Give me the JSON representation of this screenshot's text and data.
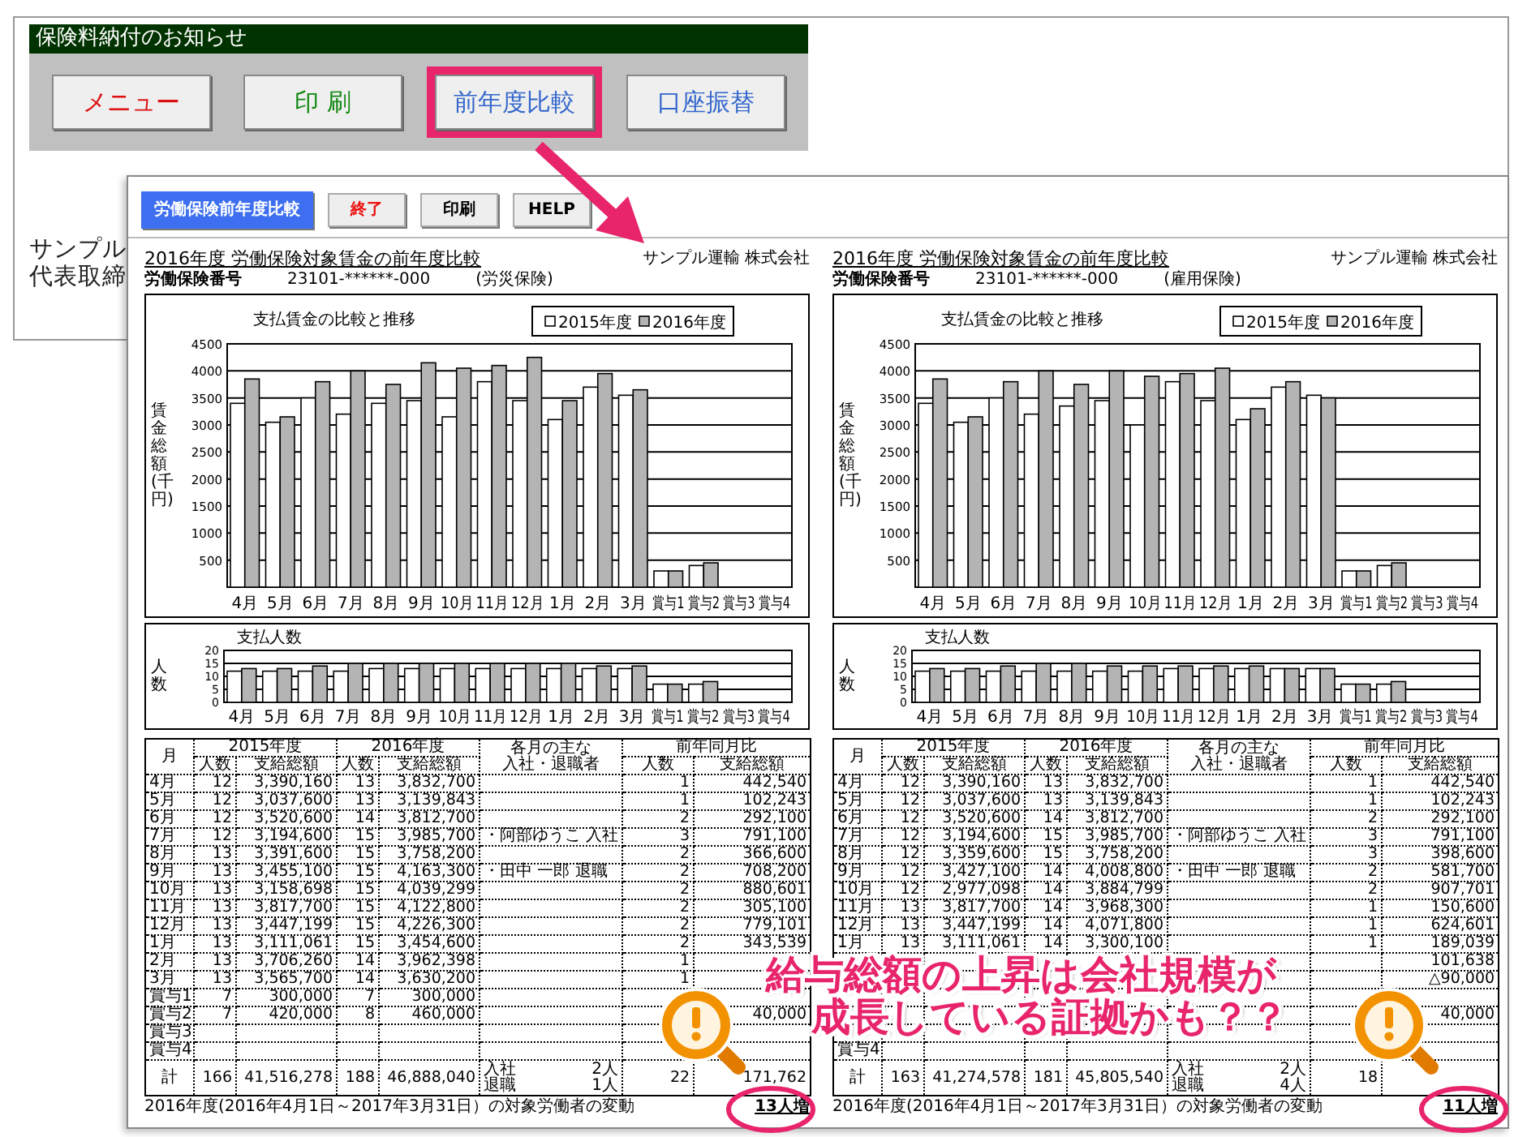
{
  "back_window": {
    "title": "保険料納付のお知らせ",
    "buttons": [
      {
        "label": "メニュー",
        "color": "#dd1111",
        "highlighted": false
      },
      {
        "label": "印 刷",
        "color": "#118811",
        "highlighted": false
      },
      {
        "label": "前年度比較",
        "color": "#3366cc",
        "highlighted": true
      },
      {
        "label": "口座振替",
        "color": "#3366cc",
        "highlighted": false
      }
    ],
    "body_lines": [
      "サンプル",
      "代表取締"
    ]
  },
  "front_window": {
    "toolbar": [
      {
        "label": "労働保険前年度比較",
        "kind": "title"
      },
      {
        "label": "終了",
        "kind": "button",
        "color": "#ee1111"
      },
      {
        "label": "印刷",
        "kind": "button",
        "color": "#000000"
      },
      {
        "label": "HELP",
        "kind": "button",
        "color": "#000000"
      }
    ],
    "reports": [
      {
        "title": "2016年度 労働保険対象賃金の前年度比較",
        "company": "サンプル運輸 株式会社",
        "number_label": "労働保険番号",
        "number": "23101-******-000",
        "insurance_type": "(労災保険)",
        "wage_chart": {
          "chart_data": {
            "type": "bar",
            "title": "支払賃金の比較と推移",
            "ylabel": "賃金総額(千円)",
            "grid": true,
            "legend": "top-right",
            "categories": [
              "4月",
              "5月",
              "6月",
              "7月",
              "8月",
              "9月",
              "10月",
              "11月",
              "12月",
              "1月",
              "2月",
              "3月",
              "賞与1",
              "賞与2",
              "賞与3",
              "賞与4"
            ],
            "ylim": [
              0,
              4500
            ],
            "yticks": [
              500,
              1000,
              1500,
              2000,
              2500,
              3000,
              3500,
              4000,
              4500
            ],
            "series": [
              {
                "name": "2015年度",
                "color": "#ffffff",
                "values": [
                  3400,
                  3050,
                  3500,
                  3200,
                  3400,
                  3450,
                  3150,
                  3800,
                  3450,
                  3100,
                  3700,
                  3550,
                  300,
                  400,
                  null,
                  null
                ]
              },
              {
                "name": "2016年度",
                "color": "#b4b4b4",
                "values": [
                  3850,
                  3150,
                  3800,
                  4000,
                  3750,
                  4150,
                  4050,
                  4100,
                  4250,
                  3450,
                  3950,
                  3650,
                  300,
                  450,
                  null,
                  null
                ]
              }
            ]
          }
        },
        "headcount_chart": {
          "chart_data": {
            "type": "bar",
            "title": "支払人数",
            "ylabel": "人数",
            "grid": true,
            "categories": [
              "4月",
              "5月",
              "6月",
              "7月",
              "8月",
              "9月",
              "10月",
              "11月",
              "12月",
              "1月",
              "2月",
              "3月",
              "賞与1",
              "賞与2",
              "賞与3",
              "賞与4"
            ],
            "ylim": [
              0,
              20
            ],
            "yticks": [
              0,
              5,
              10,
              15,
              20
            ],
            "series": [
              {
                "color": "#ffffff",
                "values": [
                  12,
                  12,
                  12,
                  12,
                  13,
                  13,
                  13,
                  13,
                  13,
                  13,
                  13,
                  13,
                  7,
                  7,
                  null,
                  null
                ]
              },
              {
                "color": "#b4b4b4",
                "values": [
                  13,
                  13,
                  14,
                  15,
                  15,
                  15,
                  15,
                  15,
                  15,
                  15,
                  14,
                  14,
                  7,
                  8,
                  null,
                  null
                ]
              }
            ]
          }
        },
        "table": {
          "columns": [
            {
              "lines": [
                "月"
              ]
            },
            {
              "label": "2015年度",
              "colspan": 2,
              "sub": [
                "人数",
                "支給総額"
              ]
            },
            {
              "label": "2016年度",
              "colspan": 2,
              "sub": [
                "人数",
                "支給総額"
              ]
            },
            {
              "lines": [
                "各月の主な",
                "入社・退職者"
              ]
            },
            {
              "label": "前年同月比",
              "colspan": 2,
              "sub": [
                "人数",
                "支給総額"
              ]
            }
          ],
          "rows": [
            {
              "kind": "month",
              "cells": [
                "4月",
                "12",
                "3,390,160",
                "13",
                "3,832,700",
                null,
                "1",
                "442,540"
              ]
            },
            {
              "kind": "month",
              "cells": [
                "5月",
                "12",
                "3,037,600",
                "13",
                "3,139,843",
                null,
                "1",
                "102,243"
              ]
            },
            {
              "kind": "month",
              "cells": [
                "6月",
                "12",
                "3,520,600",
                "14",
                "3,812,700",
                null,
                "2",
                "292,100"
              ]
            },
            {
              "kind": "month",
              "cells": [
                "7月",
                "12",
                "3,194,600",
                "15",
                "3,985,700",
                "・阿部ゆうこ 入社",
                "3",
                "791,100"
              ]
            },
            {
              "kind": "month",
              "cells": [
                "8月",
                "13",
                "3,391,600",
                "15",
                "3,758,200",
                null,
                "2",
                "366,600"
              ]
            },
            {
              "kind": "month",
              "cells": [
                "9月",
                "13",
                "3,455,100",
                "15",
                "4,163,300",
                "・田中 一郎 退職",
                "2",
                "708,200"
              ]
            },
            {
              "kind": "month",
              "cells": [
                "10月",
                "13",
                "3,158,698",
                "15",
                "4,039,299",
                null,
                "2",
                "880,601"
              ]
            },
            {
              "kind": "month",
              "cells": [
                "11月",
                "13",
                "3,817,700",
                "15",
                "4,122,800",
                null,
                "2",
                "305,100"
              ]
            },
            {
              "kind": "month",
              "cells": [
                "12月",
                "13",
                "3,447,199",
                "15",
                "4,226,300",
                null,
                "2",
                "779,101"
              ]
            },
            {
              "kind": "month",
              "cells": [
                "1月",
                "13",
                "3,111,061",
                "15",
                "3,454,600",
                null,
                "2",
                "343,539"
              ]
            },
            {
              "kind": "month",
              "cells": [
                "2月",
                "13",
                "3,706,260",
                "14",
                "3,962,398",
                null,
                "1",
                null
              ]
            },
            {
              "kind": "month",
              "cells": [
                "3月",
                "13",
                "3,565,700",
                "14",
                "3,630,200",
                null,
                "1",
                null
              ]
            },
            {
              "kind": "month",
              "cells": [
                "賞与1",
                "7",
                "300,000",
                "7",
                "300,000",
                null,
                null,
                null
              ]
            },
            {
              "kind": "month",
              "cells": [
                "賞与2",
                "7",
                "420,000",
                "8",
                "460,000",
                null,
                null,
                "40,000"
              ]
            },
            {
              "kind": "month",
              "cells": [
                "賞与3",
                null,
                null,
                null,
                null,
                null,
                null,
                null
              ]
            },
            {
              "kind": "month",
              "cells": [
                "賞与4",
                null,
                null,
                null,
                null,
                null,
                null,
                null
              ]
            },
            {
              "kind": "total",
              "cells": [
                "計",
                "166",
                "41,516,278",
                "188",
                "46,888,040",
                [
                  [
                    "入社",
                    "2人"
                  ],
                  [
                    "退職",
                    "1人"
                  ]
                ],
                "22",
                "171,762"
              ]
            }
          ]
        },
        "footer": {
          "text": "2016年度(2016年4月1日～2017年3月31日）の対象労働者の変動",
          "change": "13人増"
        }
      },
      {
        "title": "2016年度 労働保険対象賃金の前年度比較",
        "company": "サンプル運輸 株式会社",
        "number_label": "労働保険番号",
        "number": "23101-******-000",
        "insurance_type": "(雇用保険)",
        "wage_chart": {
          "chart_data": {
            "type": "bar",
            "title": "支払賃金の比較と推移",
            "ylabel": "賃金総額(千円)",
            "grid": true,
            "legend": "top-right",
            "categories": [
              "4月",
              "5月",
              "6月",
              "7月",
              "8月",
              "9月",
              "10月",
              "11月",
              "12月",
              "1月",
              "2月",
              "3月",
              "賞与1",
              "賞与2",
              "賞与3",
              "賞与4"
            ],
            "ylim": [
              0,
              4500
            ],
            "yticks": [
              500,
              1000,
              1500,
              2000,
              2500,
              3000,
              3500,
              4000,
              4500
            ],
            "series": [
              {
                "name": "2015年度",
                "color": "#ffffff",
                "values": [
                  3400,
                  3050,
                  3500,
                  3200,
                  3350,
                  3450,
                  3000,
                  3800,
                  3450,
                  3100,
                  3700,
                  3550,
                  300,
                  400,
                  null,
                  null
                ]
              },
              {
                "name": "2016年度",
                "color": "#b4b4b4",
                "values": [
                  3850,
                  3150,
                  3800,
                  4000,
                  3750,
                  4000,
                  3900,
                  3950,
                  4050,
                  3300,
                  3800,
                  3500,
                  300,
                  450,
                  null,
                  null
                ]
              }
            ]
          }
        },
        "headcount_chart": {
          "chart_data": {
            "type": "bar",
            "title": "支払人数",
            "ylabel": "人数",
            "grid": true,
            "categories": [
              "4月",
              "5月",
              "6月",
              "7月",
              "8月",
              "9月",
              "10月",
              "11月",
              "12月",
              "1月",
              "2月",
              "3月",
              "賞与1",
              "賞与2",
              "賞与3",
              "賞与4"
            ],
            "ylim": [
              0,
              20
            ],
            "yticks": [
              0,
              5,
              10,
              15,
              20
            ],
            "series": [
              {
                "color": "#ffffff",
                "values": [
                  12,
                  12,
                  12,
                  12,
                  12,
                  12,
                  12,
                  13,
                  13,
                  13,
                  13,
                  13,
                  7,
                  7,
                  null,
                  null
                ]
              },
              {
                "color": "#b4b4b4",
                "values": [
                  13,
                  13,
                  14,
                  15,
                  15,
                  14,
                  14,
                  14,
                  14,
                  14,
                  13,
                  13,
                  7,
                  8,
                  null,
                  null
                ]
              }
            ]
          }
        },
        "table": {
          "columns": [
            {
              "lines": [
                "月"
              ]
            },
            {
              "label": "2015年度",
              "colspan": 2,
              "sub": [
                "人数",
                "支給総額"
              ]
            },
            {
              "label": "2016年度",
              "colspan": 2,
              "sub": [
                "人数",
                "支給総額"
              ]
            },
            {
              "lines": [
                "各月の主な",
                "入社・退職者"
              ]
            },
            {
              "label": "前年同月比",
              "colspan": 2,
              "sub": [
                "人数",
                "支給総額"
              ]
            }
          ],
          "rows": [
            {
              "kind": "month",
              "cells": [
                "4月",
                "12",
                "3,390,160",
                "13",
                "3,832,700",
                null,
                "1",
                "442,540"
              ]
            },
            {
              "kind": "month",
              "cells": [
                "5月",
                "12",
                "3,037,600",
                "13",
                "3,139,843",
                null,
                "1",
                "102,243"
              ]
            },
            {
              "kind": "month",
              "cells": [
                "6月",
                "12",
                "3,520,600",
                "14",
                "3,812,700",
                null,
                "2",
                "292,100"
              ]
            },
            {
              "kind": "month",
              "cells": [
                "7月",
                "12",
                "3,194,600",
                "15",
                "3,985,700",
                "・阿部ゆうこ 入社",
                "3",
                "791,100"
              ]
            },
            {
              "kind": "month",
              "cells": [
                "8月",
                "12",
                "3,359,600",
                "15",
                "3,758,200",
                null,
                "3",
                "398,600"
              ]
            },
            {
              "kind": "month",
              "cells": [
                "9月",
                "12",
                "3,427,100",
                "14",
                "4,008,800",
                "・田中 一郎 退職",
                "2",
                "581,700"
              ]
            },
            {
              "kind": "month",
              "cells": [
                "10月",
                "12",
                "2,977,098",
                "14",
                "3,884,799",
                null,
                "2",
                "907,701"
              ]
            },
            {
              "kind": "month",
              "cells": [
                "11月",
                "13",
                "3,817,700",
                "14",
                "3,968,300",
                null,
                "1",
                "150,600"
              ]
            },
            {
              "kind": "month",
              "cells": [
                "12月",
                "13",
                "3,447,199",
                "14",
                "4,071,800",
                null,
                "1",
                "624,601"
              ]
            },
            {
              "kind": "month",
              "cells": [
                "1月",
                "13",
                "3,111,061",
                "14",
                "3,300,100",
                null,
                "1",
                "189,039"
              ]
            },
            {
              "kind": "month",
              "cells": [
                null,
                null,
                null,
                null,
                null,
                null,
                null,
                "101,638"
              ]
            },
            {
              "kind": "month",
              "cells": [
                null,
                null,
                null,
                null,
                null,
                null,
                null,
                "△90,000"
              ]
            },
            {
              "kind": "month",
              "cells": [
                null,
                null,
                null,
                null,
                null,
                null,
                null,
                null
              ]
            },
            {
              "kind": "month",
              "cells": [
                null,
                null,
                null,
                null,
                null,
                null,
                null,
                "40,000"
              ]
            },
            {
              "kind": "month",
              "cells": [
                null,
                null,
                null,
                null,
                null,
                null,
                null,
                null
              ]
            },
            {
              "kind": "month",
              "cells": [
                "賞与4",
                null,
                null,
                null,
                null,
                null,
                null,
                null
              ]
            },
            {
              "kind": "total",
              "cells": [
                "計",
                "163",
                "41,274,578",
                "181",
                "45,805,540",
                [
                  [
                    "入社",
                    "2人"
                  ],
                  [
                    "退職",
                    "4人"
                  ]
                ],
                "18",
                null
              ]
            }
          ]
        },
        "footer": {
          "text": "2016年度(2016年4月1日～2017年3月31日）の対象労働者の変動",
          "change": "11人増"
        }
      }
    ]
  },
  "callout": {
    "lines": [
      "給与総額の上昇は会社規模が",
      "成長している証拠かも？？"
    ]
  }
}
